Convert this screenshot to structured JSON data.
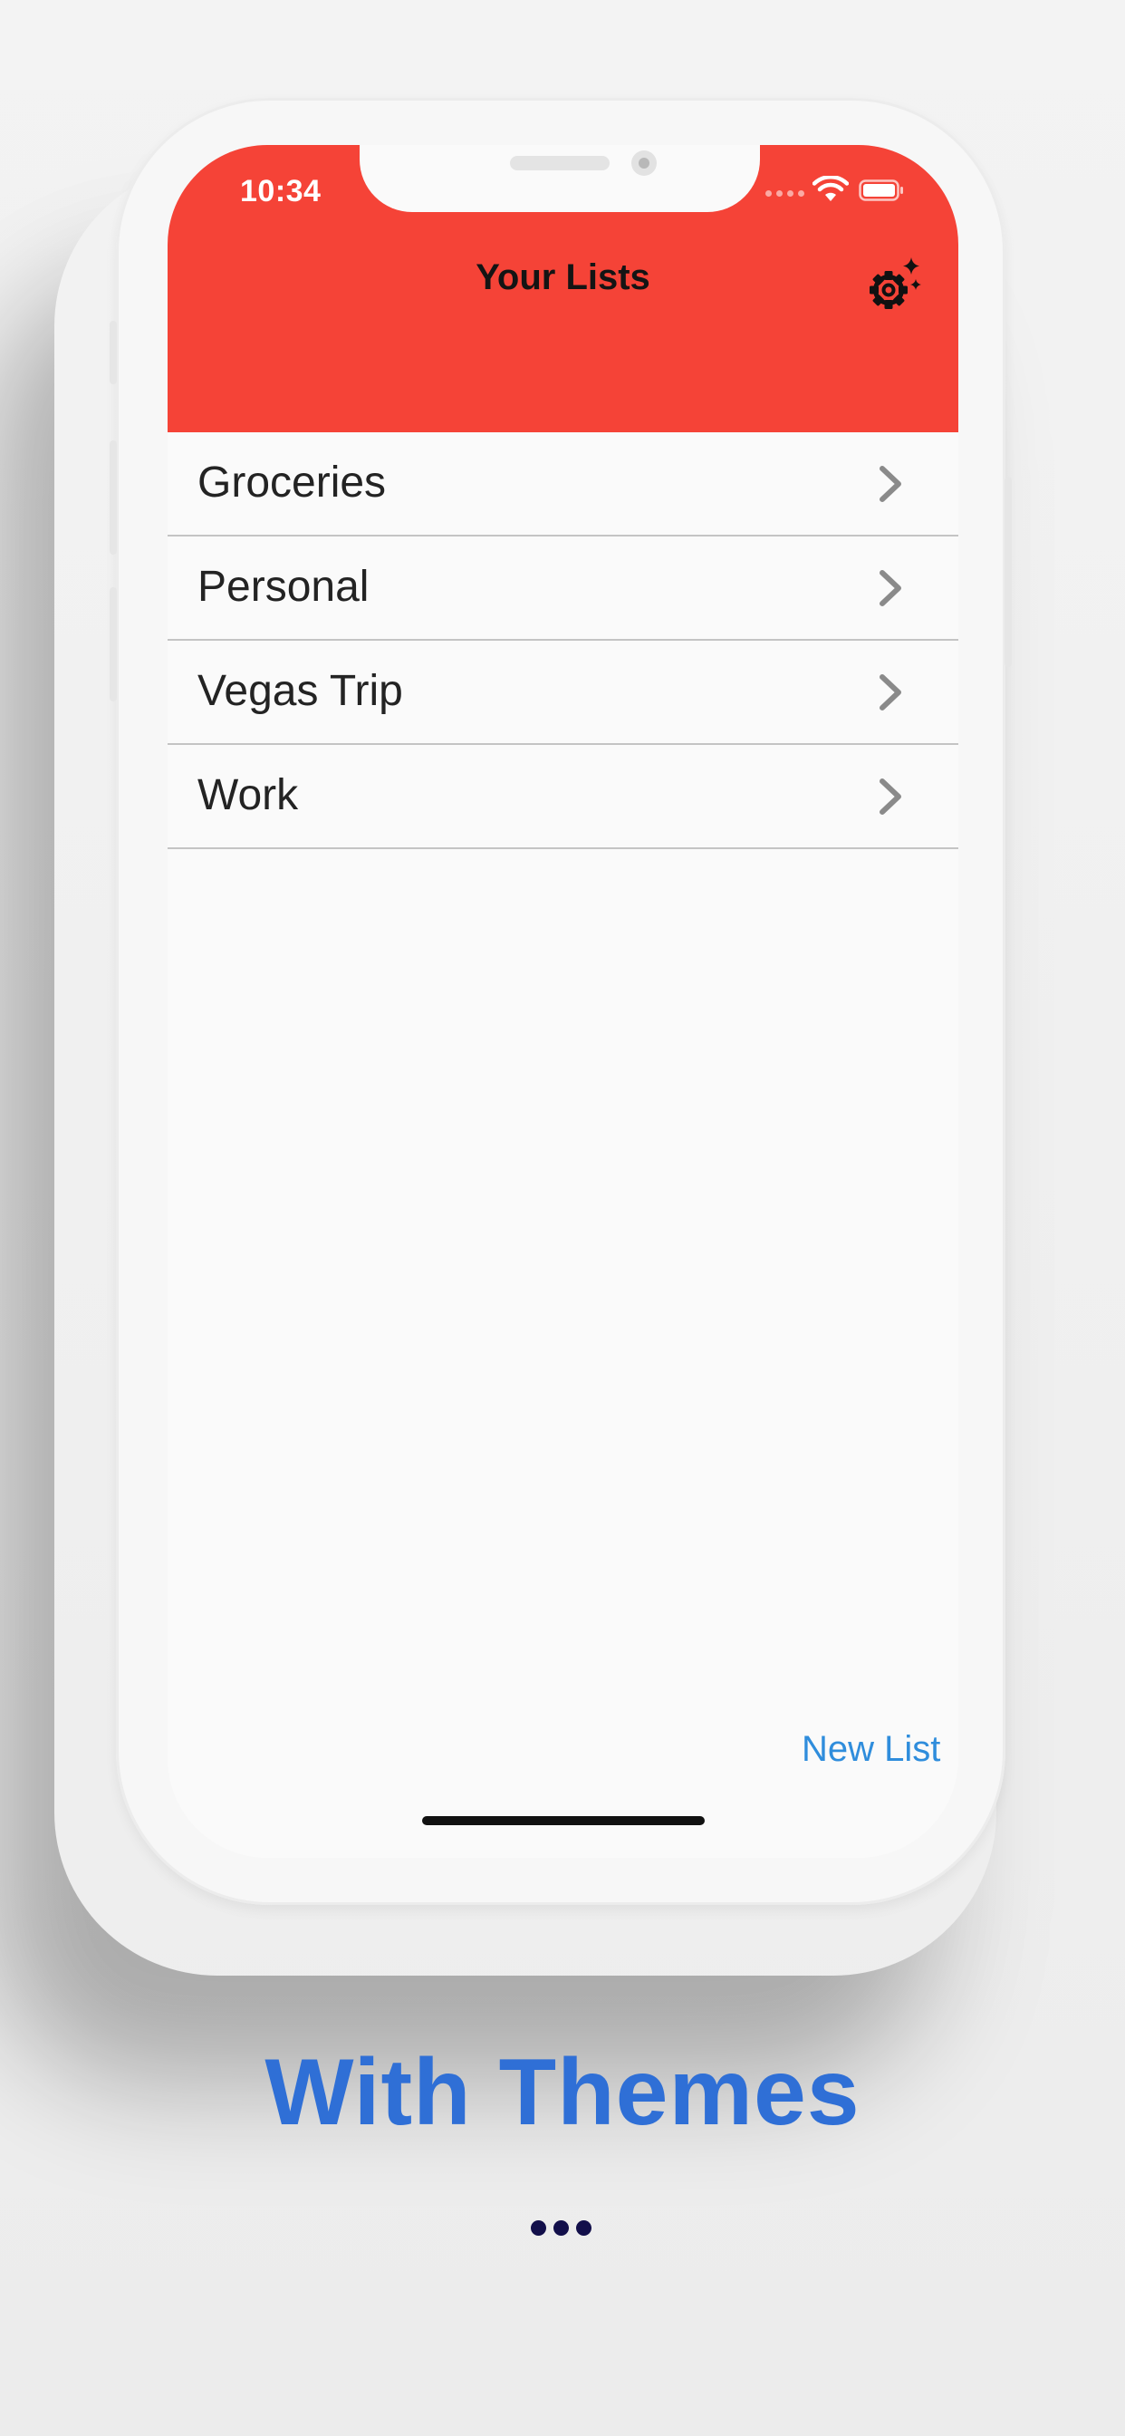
{
  "status_bar": {
    "time": "10:34"
  },
  "nav": {
    "title": "Your Lists",
    "settings_icon": "gear-sparkle-icon"
  },
  "lists": [
    {
      "label": "Groceries"
    },
    {
      "label": "Personal"
    },
    {
      "label": "Vegas Trip"
    },
    {
      "label": "Work"
    }
  ],
  "footer": {
    "new_list_label": "New List"
  },
  "caption": {
    "text": "With Themes"
  },
  "colors": {
    "header": "#f54337",
    "accent": "#2f8ddc",
    "caption": "#2f6fd6",
    "dots": "#120f4a"
  }
}
